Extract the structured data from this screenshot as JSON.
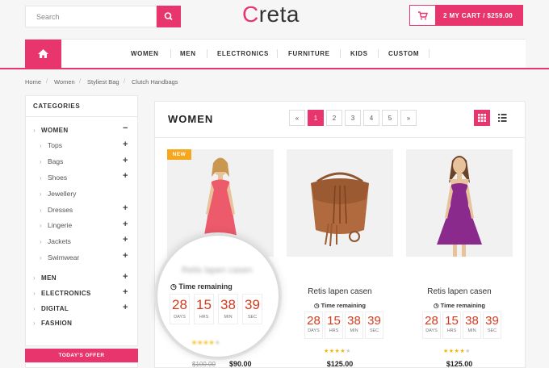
{
  "header": {
    "search_placeholder": "Search",
    "logo_first": "C",
    "logo_rest": "reta",
    "cart_label": "2   MY CART / $259.00"
  },
  "nav": {
    "items": [
      "WOMEN",
      "MEN",
      "ELECTRONICS",
      "FURNITURE",
      "KIDS",
      "CUSTOM"
    ]
  },
  "breadcrumb": [
    "Home",
    "Women",
    "Styliest Bag",
    "Clutch Handbags"
  ],
  "sidebar": {
    "title": "CATEGORIES",
    "active": "WOMEN",
    "sub": [
      "Tops",
      "Bags",
      "Shoes",
      "Jewellery",
      "Dresses",
      "Lingerie",
      "Jackets",
      "Swimwear"
    ],
    "top": [
      "MEN",
      "ELECTRONICS",
      "DIGITAL",
      "FASHION"
    ],
    "offer": "TODAY'S OFFER"
  },
  "main": {
    "title": "WOMEN",
    "pagination": [
      "«",
      "1",
      "2",
      "3",
      "4",
      "5",
      "»"
    ],
    "badge_new": "NEW",
    "products": [
      {
        "name": "Retis lapen casen",
        "time_label": "Time remaining",
        "days": "28",
        "hrs": "15",
        "min": "38",
        "sec": "39",
        "old_price": "$100.00",
        "price": "$90.00",
        "rating": 4
      },
      {
        "name": "Retis lapen casen",
        "time_label": "Time remaining",
        "days": "28",
        "hrs": "15",
        "min": "38",
        "sec": "39",
        "price": "$125.00",
        "rating": 4
      },
      {
        "name": "Retis lapen casen",
        "time_label": "Time remaining",
        "days": "28",
        "hrs": "15",
        "min": "38",
        "sec": "39",
        "price": "$125.00",
        "rating": 4
      }
    ],
    "unit_labels": {
      "days": "DAYS",
      "hrs": "HRS",
      "min": "MIN",
      "sec": "SEC"
    }
  },
  "colors": {
    "accent": "#e8356e",
    "countdown": "#d63a1e",
    "badge": "#f6a71c",
    "star": "#f5b400"
  }
}
